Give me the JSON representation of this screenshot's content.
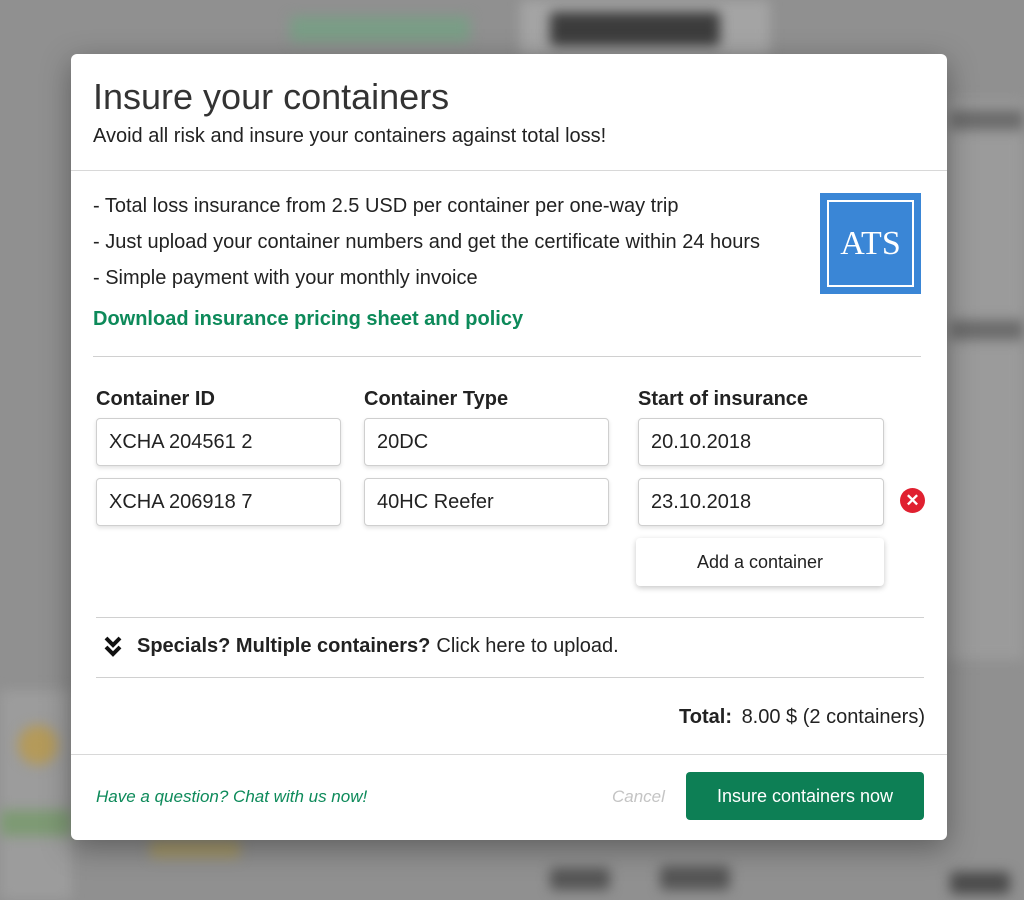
{
  "modal": {
    "title": "Insure your containers",
    "subtitle": "Avoid all risk and insure your containers against total loss!",
    "features": [
      "- Total loss insurance from 2.5 USD per container per one-way trip",
      "- Just upload your container numbers and get the certificate within 24 hours",
      "- Simple payment with your monthly invoice"
    ],
    "download_link": "Download insurance pricing sheet and policy",
    "logo_text": "ATS",
    "columns": {
      "container_id": "Container ID",
      "container_type": "Container Type",
      "start": "Start of insurance"
    },
    "rows": [
      {
        "id": "XCHA 204561 2",
        "type": "20DC",
        "start": "20.10.2018"
      },
      {
        "id": "XCHA 206918 7",
        "type": "40HC Reefer",
        "start": "23.10.2018"
      }
    ],
    "add_container": "Add a container",
    "specials_bold": "Specials? Multiple containers?",
    "specials_text": "Click here to upload.",
    "total_label": "Total:",
    "total_value": "8.00 $ (2 containers)",
    "chat_link": "Have a question? Chat with us now!",
    "cancel": "Cancel",
    "submit": "Insure containers now"
  },
  "colors": {
    "accent_green": "#0d8a5a",
    "button_green": "#0d7f55",
    "remove_red": "#e02030",
    "logo_blue": "#3a86d6"
  },
  "icons": {
    "remove": "remove-circle-icon",
    "expand": "double-chevron-down-icon"
  }
}
